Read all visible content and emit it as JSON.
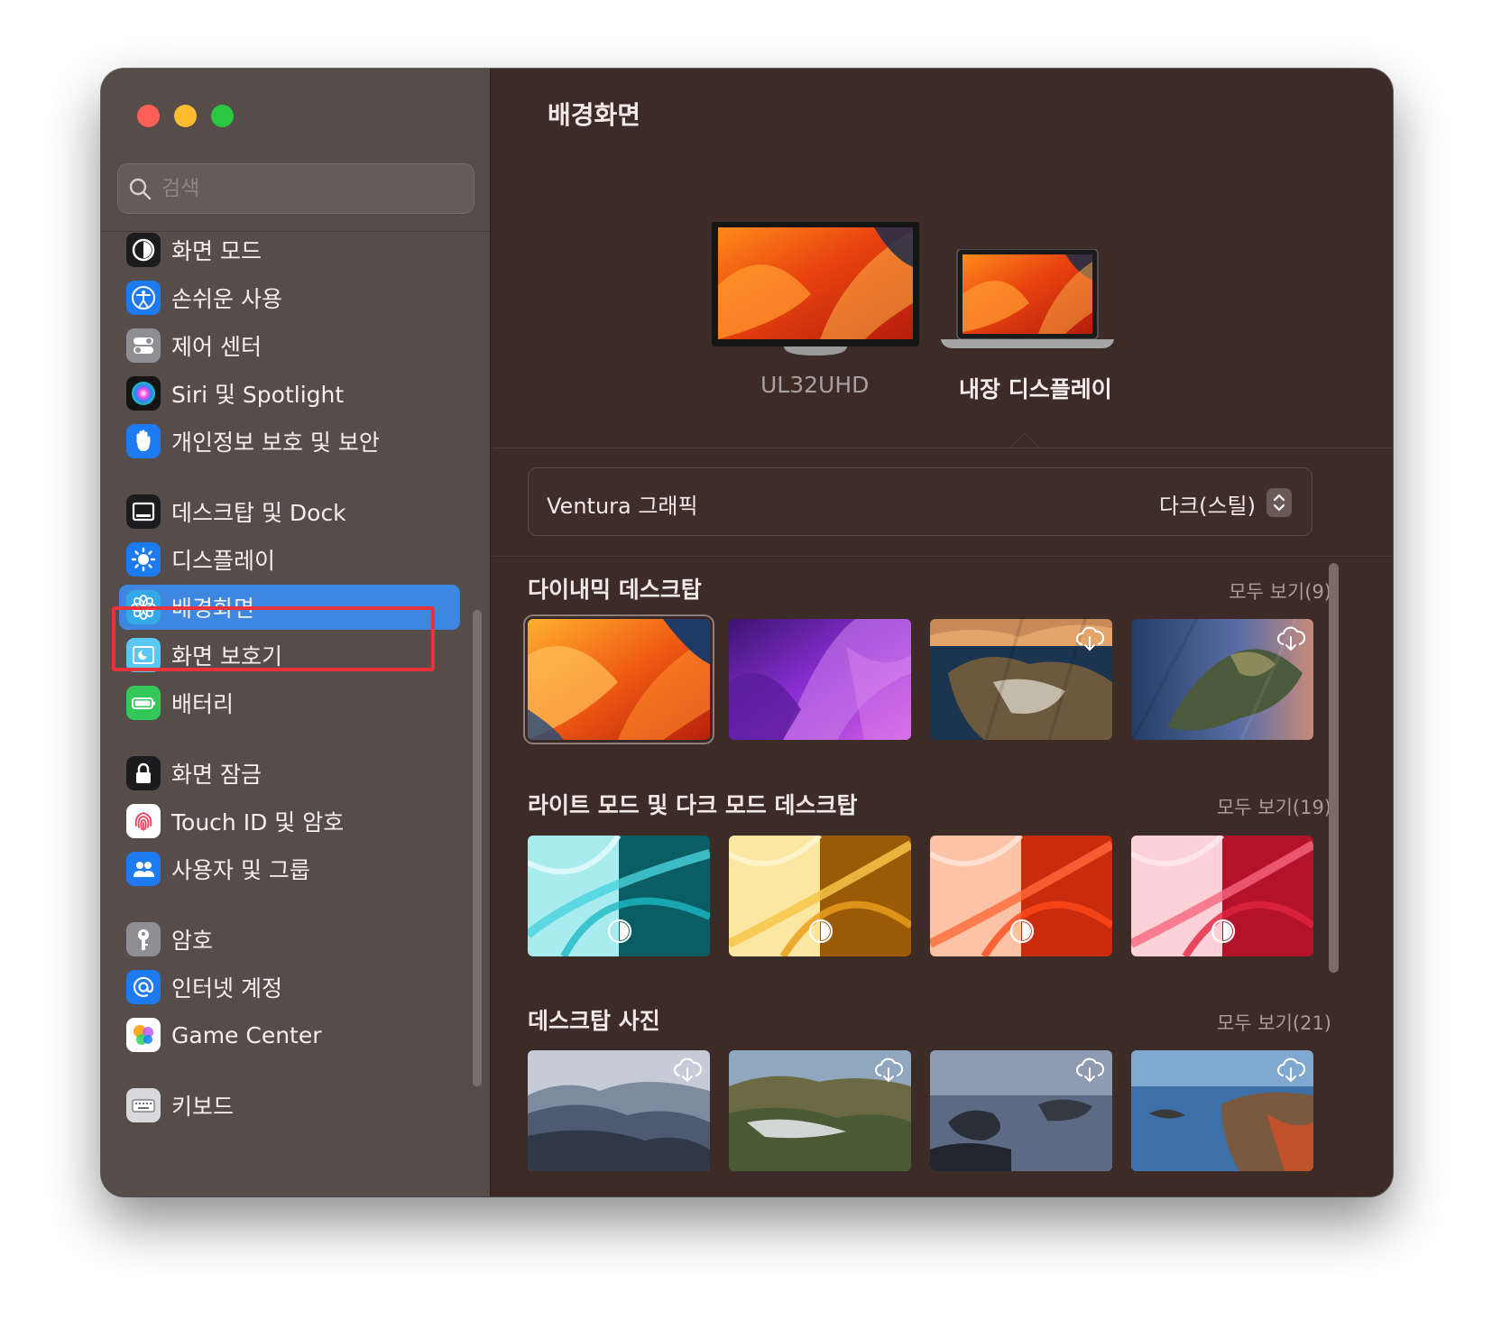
{
  "window": {
    "title": "배경화면"
  },
  "search": {
    "placeholder": "검색"
  },
  "sidebar": {
    "items": [
      {
        "label": "화면 모드",
        "icon": "appearance-icon"
      },
      {
        "label": "손쉬운 사용",
        "icon": "accessibility-icon"
      },
      {
        "label": "제어 센터",
        "icon": "control-center-icon"
      },
      {
        "label": "Siri 및 Spotlight",
        "icon": "siri-icon"
      },
      {
        "label": "개인정보 보호 및 보안",
        "icon": "hand-icon"
      },
      {
        "label": "데스크탑 및 Dock",
        "icon": "dock-icon"
      },
      {
        "label": "디스플레이",
        "icon": "sun-icon"
      },
      {
        "label": "배경화면",
        "icon": "flower-icon",
        "selected": true
      },
      {
        "label": "화면 보호기",
        "icon": "screensaver-icon"
      },
      {
        "label": "배터리",
        "icon": "battery-icon"
      },
      {
        "label": "화면 잠금",
        "icon": "lock-icon"
      },
      {
        "label": "Touch ID 및 암호",
        "icon": "fingerprint-icon"
      },
      {
        "label": "사용자 및 그룹",
        "icon": "users-icon"
      },
      {
        "label": "암호",
        "icon": "key-icon"
      },
      {
        "label": "인터넷 계정",
        "icon": "at-icon"
      },
      {
        "label": "Game Center",
        "icon": "game-center-icon"
      },
      {
        "label": "키보드",
        "icon": "keyboard-icon"
      }
    ]
  },
  "displays": [
    {
      "label": "UL32UHD",
      "selected": false
    },
    {
      "label": "내장 디스플레이",
      "selected": true
    }
  ],
  "wallpaper_select": {
    "name": "Ventura 그래픽",
    "value": "다크(스틸)"
  },
  "sections": [
    {
      "title": "다이내믹 데스크탑",
      "see_all": "모두 보기(9)",
      "thumbs": [
        "ventura-orange",
        "monterey-purple",
        "big-sur-coast",
        "catalina-island"
      ]
    },
    {
      "title": "라이트 모드 및 다크 모드 데스크탑",
      "see_all": "모두 보기(19)",
      "thumbs": [
        "teal",
        "yellow",
        "orange-red",
        "pink-red"
      ]
    },
    {
      "title": "데스크탑 사진",
      "see_all": "모두 보기(21)",
      "thumbs": [
        "misty-mountains",
        "green-hills",
        "rocks-sea",
        "coastline"
      ]
    }
  ],
  "colors": {
    "accent": "#3d87e1",
    "highlight_border": "#e8323c",
    "sidebar_bg": "#564c4a",
    "content_bg": "#3d2b28"
  }
}
